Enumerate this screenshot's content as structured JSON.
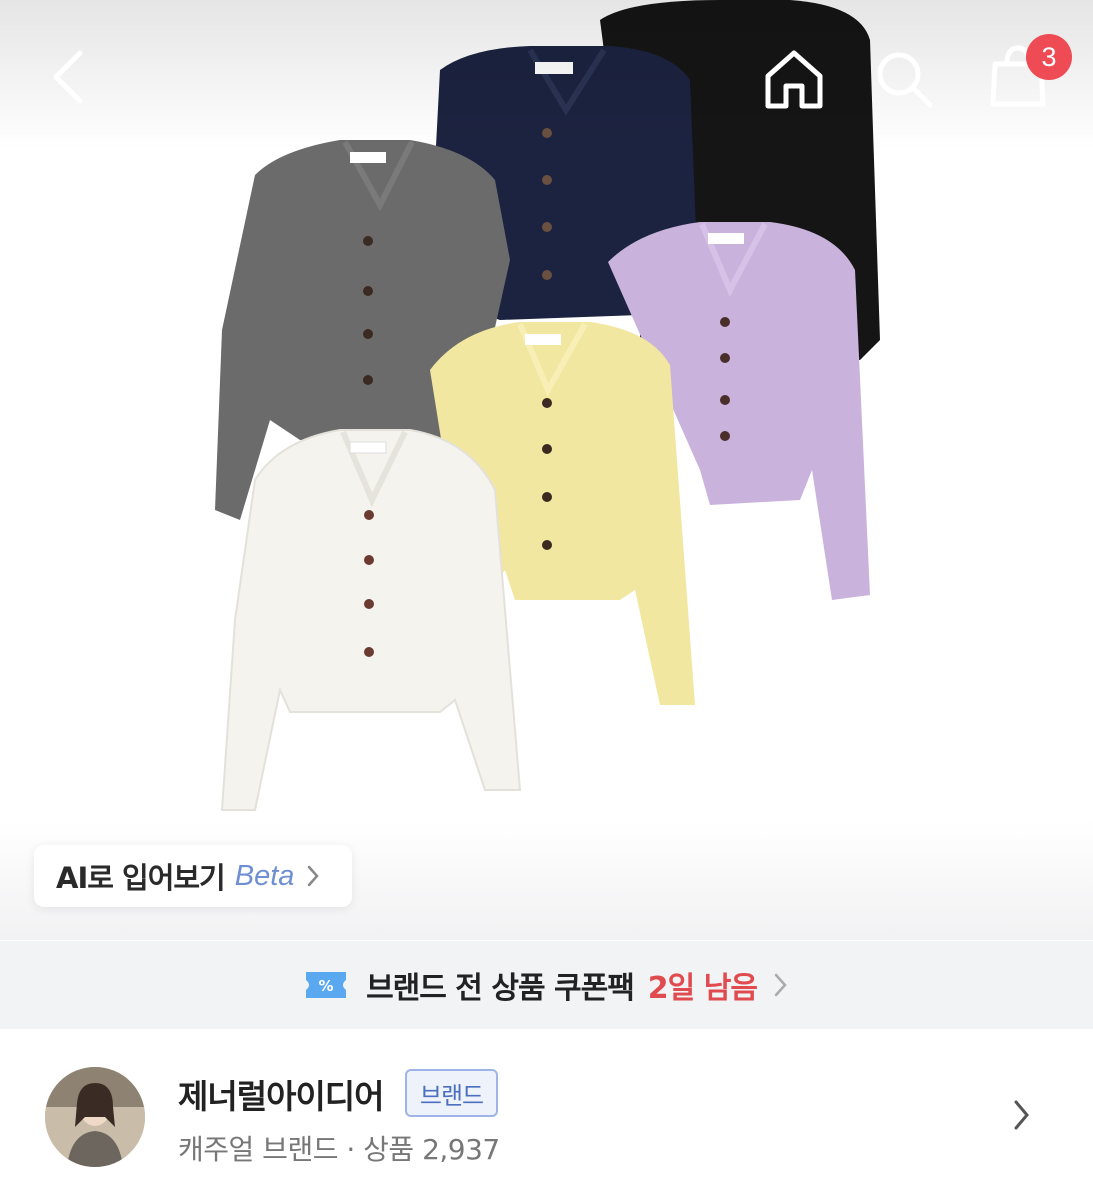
{
  "nav": {
    "back_icon": "chevron-left-icon",
    "home_icon": "home-icon",
    "search_icon": "search-icon",
    "cart_icon": "shopping-bag-icon",
    "cart_count": "3"
  },
  "product_image": {
    "cardigan_colors": [
      "#5f5f5f",
      "#1c2340",
      "#151515",
      "#c9b2dc",
      "#f1e7a0",
      "#f5f3ee"
    ]
  },
  "ai_tryon": {
    "label": "AI로 입어보기",
    "beta": "Beta"
  },
  "coupon": {
    "text": "브랜드 전 상품 쿠폰팩",
    "days_left": "2일 남음"
  },
  "brand": {
    "name": "제너럴아이디어",
    "tag": "브랜드",
    "subtitle": "캐주얼 브랜드 · 상품 2,937"
  },
  "colors": {
    "badge": "#ee4b55",
    "accent_blue": "#6f8fd3",
    "coupon_red": "#e04b50"
  }
}
